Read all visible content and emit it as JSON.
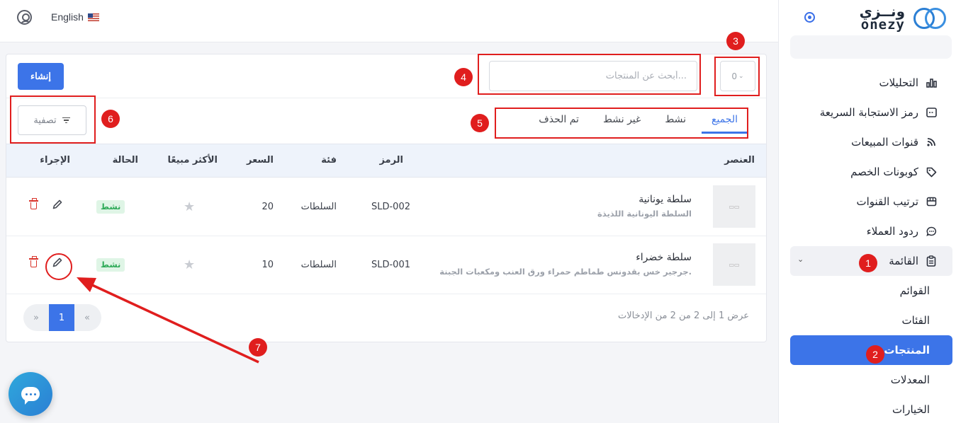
{
  "header": {
    "language": "English"
  },
  "sidebar": {
    "brand_ar": "ونــزي",
    "brand_en": "onezy",
    "items": [
      {
        "label": "التحليلات",
        "icon": "chart-icon"
      },
      {
        "label": "رمز الاستجابة السريعة",
        "icon": "qr-code-icon"
      },
      {
        "label": "قنوات المبيعات",
        "icon": "rss-icon"
      },
      {
        "label": "كوبونات الخصم",
        "icon": "tag-icon"
      },
      {
        "label": "ترتيب القنوات",
        "icon": "store-icon"
      },
      {
        "label": "ردود العملاء",
        "icon": "chat-icon"
      },
      {
        "label": "القائمة",
        "icon": "clipboard-icon",
        "expanded": true
      }
    ],
    "submenu": [
      "القوائم",
      "الفئات",
      "المنتجات",
      "المعدلات",
      "الخيارات"
    ],
    "active_submenu": "المنتجات"
  },
  "toolbar": {
    "create_label": "إنشاء",
    "search_placeholder": "أبحث عن المنتجات...",
    "page_size": "0",
    "filter_label": "تصفية"
  },
  "tabs": [
    "الجميع",
    "نشط",
    "غير نشط",
    "تم الحذف"
  ],
  "active_tab": "الجميع",
  "table": {
    "columns": {
      "item": "العنصر",
      "sku": "الرمز",
      "category": "فئة",
      "price": "السعر",
      "bestseller": "الأكثر مبيعًا",
      "status": "الحالة",
      "action": "الإجراء"
    },
    "rows": [
      {
        "name": "سلطة يونانية",
        "description": "السلطة اليونانية اللذيذة",
        "sku": "SLD-002",
        "category": "السلطات",
        "price": "20",
        "status": "نشط"
      },
      {
        "name": "سلطة خضراء",
        "description": "جرجير خس بقدونس طماطم حمراء ورق العنب ومكعبات الجبنة.",
        "sku": "SLD-001",
        "category": "السلطات",
        "price": "10",
        "status": "نشط"
      }
    ]
  },
  "footer": {
    "entries_text": "عرض 1 إلى 2 من 2 من الإدخالات",
    "pages": {
      "prev": "«",
      "current": "1",
      "next": "»"
    }
  },
  "annotations": [
    "1",
    "2",
    "3",
    "4",
    "5",
    "6",
    "7"
  ],
  "colors": {
    "accent": "#3c74e8",
    "annotation": "#e01e1e",
    "active_badge": "#2eaa58",
    "delete": "#d9342b"
  }
}
